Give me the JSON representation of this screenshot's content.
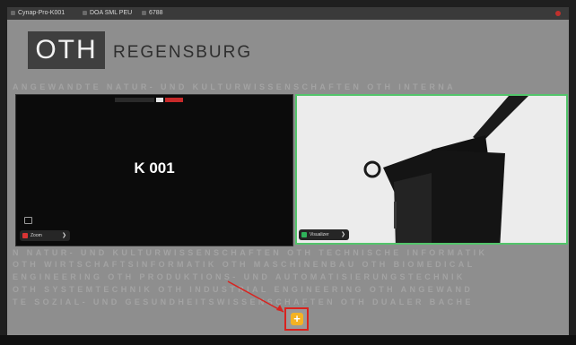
{
  "topbar": {
    "app_name": "Cynap-Pro-K001",
    "session": "DOA SML PEU",
    "pin": "6788"
  },
  "background": {
    "logo_letters": "OTH",
    "logo_word": "REGENSBURG",
    "line1": "ANGEWANDTE NATUR- UND KULTURWISSENSCHAFTEN OTH INTERNA",
    "line2": "N NATUR- UND KULTURWISSENSCHAFTEN OTH TECHNISCHE INFORMATIK",
    "line3": "OTH WIRTSCHAFTSINFORMATIK OTH MASCHINENBAU OTH BIOMEDICAL",
    "line4": "ENGINEERING OTH PRODUKTIONS- UND AUTOMATISIERUNGSTECHNIK",
    "line5": "OTH SYSTEMTECHNIK OTH INDUSTRIAL ENGINEERING OTH ANGEWAND",
    "line6": "TE SOZIAL- UND GESUNDHEITSWISSENSCHAFTEN OTH DUALER BACHE"
  },
  "tiles": [
    {
      "label": "K 001",
      "name": "Zoom",
      "chip_color": "#d93434"
    },
    {
      "name": "Visualizer",
      "chip_color": "#2fb35a"
    }
  ],
  "colors": {
    "active_border": "#53c46b",
    "add_button": "#f4b223",
    "highlight": "#d9231f"
  },
  "icons": {
    "add": "plus-icon",
    "share": "share-icon",
    "arrow": "chevron-right-icon"
  }
}
